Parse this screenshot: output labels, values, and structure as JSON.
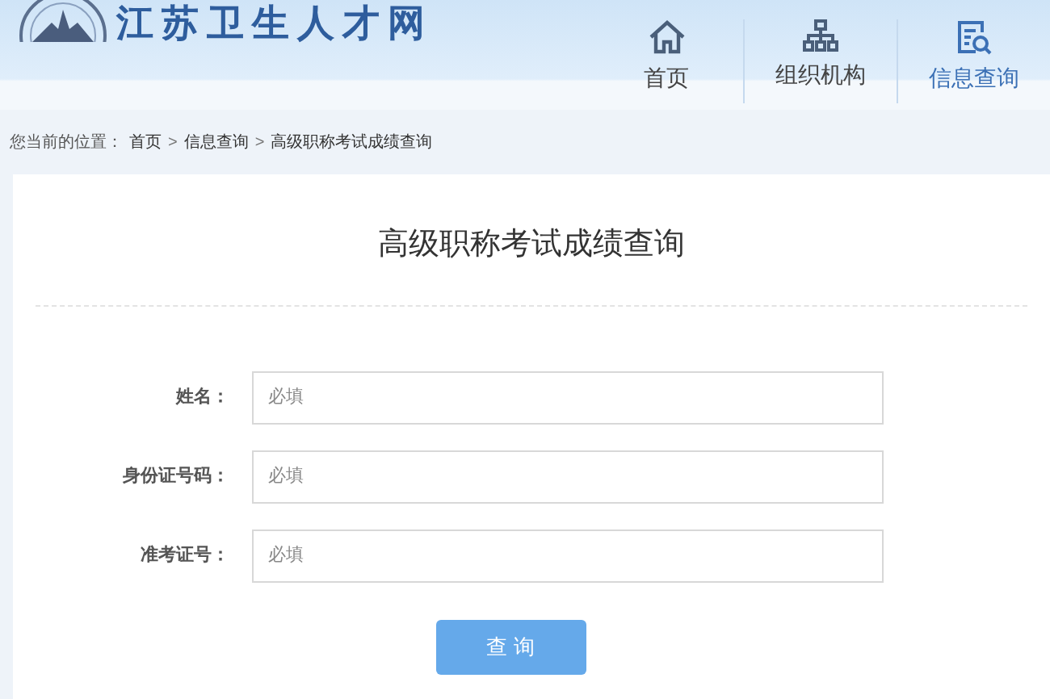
{
  "site_title": "江苏卫生人才网",
  "nav": [
    {
      "label": "首页",
      "kind": "home",
      "selected": false
    },
    {
      "label": "组织机构",
      "kind": "org",
      "selected": false
    },
    {
      "label": "信息查询",
      "kind": "search-doc",
      "selected": true
    }
  ],
  "breadcrumb": {
    "prefix": "您当前的位置：",
    "items": [
      "首页",
      "信息查询",
      "高级职称考试成绩查询"
    ],
    "separator": ">"
  },
  "form": {
    "title": "高级职称考试成绩查询",
    "fields": [
      {
        "label": "姓名：",
        "placeholder": "必填"
      },
      {
        "label": "身份证号码：",
        "placeholder": "必填"
      },
      {
        "label": "准考证号：",
        "placeholder": "必填"
      }
    ],
    "submit": "查 询"
  }
}
